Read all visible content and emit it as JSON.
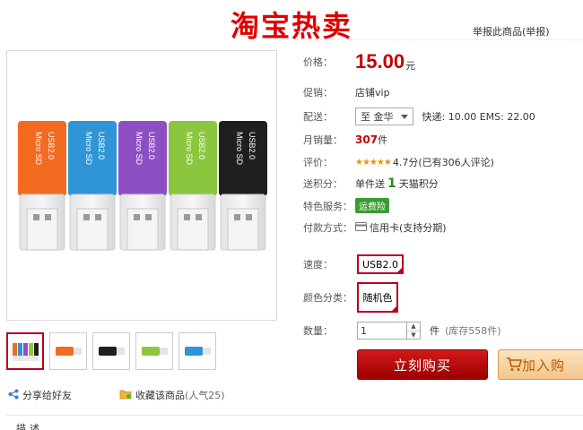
{
  "banner": {
    "title": "淘宝热卖"
  },
  "header": {
    "report_link": "举报此商品(举报)"
  },
  "product": {
    "price_label": "价格：",
    "price_value": "15.00",
    "price_unit": "元",
    "promo_label": "促销：",
    "promo_value": "店铺vip",
    "ship_label": "配送：",
    "ship_to": "至 金华",
    "ship_info": "快递: 10.00 EMS: 22.00",
    "sales_label": "月销量：",
    "sales_value": "307",
    "sales_unit": "件",
    "rating_label": "评价：",
    "rating_stars": "★★★★★",
    "rating_text": "4.7分(已有306人评论)",
    "points_label": "送积分：",
    "points_prefix": "单件送",
    "points_value": "1",
    "points_suffix": "天猫积分",
    "service_label": "特色服务：",
    "service_badge": "运费险",
    "payment_label": "付款方式：",
    "payment_value": "信用卡(支持分期)",
    "speed_label": "速度：",
    "speed_option": "USB2.0",
    "color_label": "颜色分类：",
    "color_option": "随机色",
    "qty_label": "数量：",
    "qty_value": "1",
    "qty_unit": "件",
    "stock": "(库存558件)"
  },
  "actions": {
    "buy_now": "立刻购买",
    "add_cart": "加入购"
  },
  "footer": {
    "share": "分享给好友",
    "fav": "收藏该商品",
    "fav_popularity": "(人气25)",
    "fragment": "描述"
  },
  "colors": {
    "accent_red": "#c40000",
    "brand_red": "#e10000",
    "selected_border": "#b8001e",
    "green": "#2a8c1a"
  },
  "product_image": {
    "card_colors": [
      "#f26b21",
      "#2f95d6",
      "#8e4fc4",
      "#8cc63f",
      "#1f1f1f"
    ],
    "card_text": [
      "Micro SD",
      "USB2.0"
    ]
  }
}
